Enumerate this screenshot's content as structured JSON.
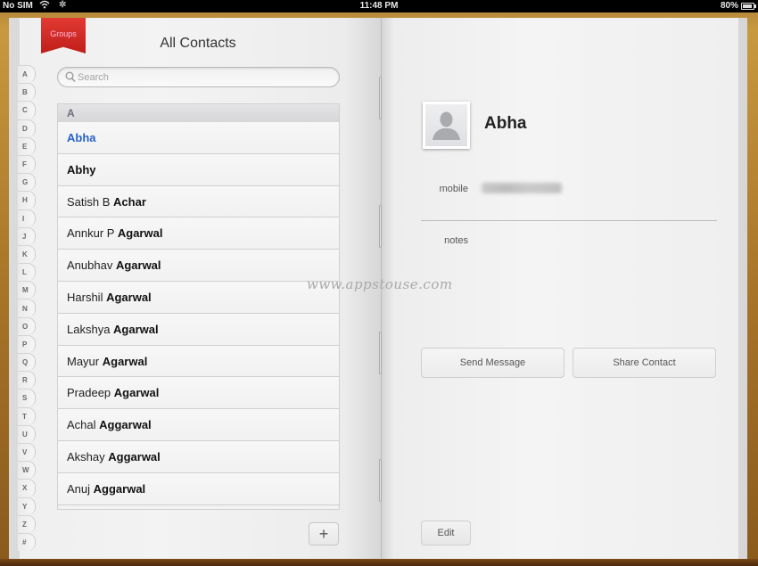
{
  "status_bar": {
    "carrier": "No SIM",
    "wifi_icon": "wifi-icon",
    "activity_icon": "spinner-icon",
    "time": "11:48 PM",
    "battery_percent": "80%",
    "battery_level": 0.8
  },
  "left_page": {
    "groups_ribbon": "Groups",
    "title": "All Contacts",
    "search": {
      "placeholder": "Search",
      "value": ""
    },
    "alpha_index": [
      "A",
      "B",
      "C",
      "D",
      "E",
      "F",
      "G",
      "H",
      "I",
      "J",
      "K",
      "L",
      "M",
      "N",
      "O",
      "P",
      "Q",
      "R",
      "S",
      "T",
      "U",
      "V",
      "W",
      "X",
      "Y",
      "Z",
      "#"
    ],
    "sections": [
      {
        "header": "A",
        "contacts": [
          {
            "first": "",
            "last": "Abha",
            "selected": true
          },
          {
            "first": "",
            "last": "Abhy",
            "selected": false
          },
          {
            "first": "Satish B",
            "last": "Achar",
            "selected": false
          },
          {
            "first": "Annkur P",
            "last": "Agarwal",
            "selected": false
          },
          {
            "first": "Anubhav",
            "last": "Agarwal",
            "selected": false
          },
          {
            "first": "Harshil",
            "last": "Agarwal",
            "selected": false
          },
          {
            "first": "Lakshya",
            "last": "Agarwal",
            "selected": false
          },
          {
            "first": "Mayur",
            "last": "Agarwal",
            "selected": false
          },
          {
            "first": "Pradeep",
            "last": "Agarwal",
            "selected": false
          },
          {
            "first": "Achal",
            "last": "Aggarwal",
            "selected": false
          },
          {
            "first": "Akshay",
            "last": "Aggarwal",
            "selected": false
          },
          {
            "first": "Anuj",
            "last": "Aggarwal",
            "selected": false
          }
        ]
      }
    ],
    "add_button": "+"
  },
  "watermark": "www.appstouse.com",
  "right_page": {
    "contact_name": "Abha",
    "avatar_icon": "person-silhouette-icon",
    "fields": [
      {
        "label": "mobile",
        "value": "(blurred)"
      },
      {
        "label": "notes",
        "value": ""
      }
    ],
    "buttons": {
      "send_message": "Send Message",
      "share_contact": "Share Contact",
      "edit": "Edit"
    }
  },
  "colors": {
    "selected_contact": "#2a62c8",
    "ribbon": "#d12a24",
    "cover": "#a87428"
  }
}
